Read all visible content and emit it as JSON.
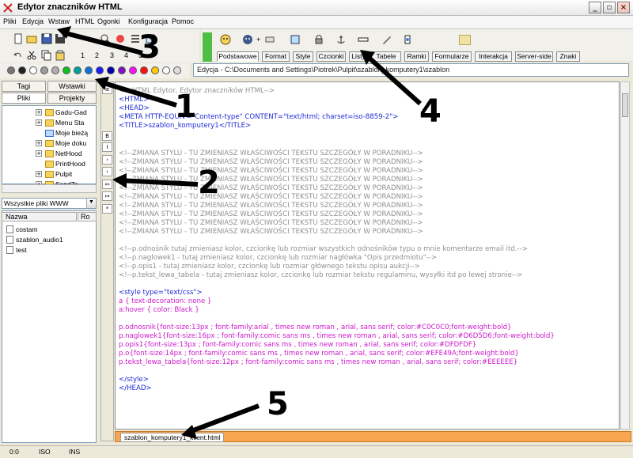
{
  "app": {
    "title": "Edytor znaczników HTML"
  },
  "menu": [
    "Pliki",
    "Edycja",
    "Wstaw",
    "HTML",
    "Ogonki",
    "Konfiguracja",
    "Pomoc"
  ],
  "toolbar": {
    "numbers": [
      "1",
      "2",
      "3",
      "4",
      "5"
    ],
    "tabs": [
      "Podstawowe",
      "Format",
      "Style",
      "Czcionki",
      "Listy",
      "Tabele",
      "Ramki",
      "Formularze",
      "Interakcja",
      "Server-side",
      "Znaki"
    ],
    "active_tab": "Podstawowe",
    "path": "Edycja - C:\\Documents and Settings\\Piotrek\\Pulpit\\szablon_komputery1\\szablon"
  },
  "left_panel": {
    "tabs_top": [
      "Tagi",
      "Wstawki"
    ],
    "tabs_bottom": [
      "Pliki",
      "Projekty"
    ],
    "tree": [
      "Gadu-Gad",
      "Menu Sta",
      "Moje bieżą",
      "Moje doku",
      "NetHood",
      "PrintHood",
      "Pulpit",
      "SendTo"
    ],
    "filter": "Wszystkie pliki WWW",
    "file_columns": [
      "Nazwa",
      "Ro"
    ],
    "files": [
      "costam",
      "szablon_audio1",
      "test"
    ]
  },
  "editor": {
    "lines": [
      {
        "text": "<!--HTML Edytor, Edytor znaczników HTML-->",
        "color": "#909090"
      },
      {
        "text": "<HTML>",
        "color": "#1e2bd8"
      },
      {
        "text": "<HEAD>",
        "color": "#1e2bd8"
      },
      {
        "text": "<META HTTP-EQUIV=\"Content-type\" CONTENT=\"text/html; charset=iso-8859-2\">",
        "color": "#1e2bd8"
      },
      {
        "text": "<TITLE>szablon_komputery1</TITLE>",
        "color": "#1e2bd8"
      },
      {
        "text": "",
        "color": "#000"
      },
      {
        "text": "",
        "color": "#000"
      },
      {
        "text": "<!--ZMIANA STYLU - TU ZMIENIASZ WŁAŚCIWOŚCI TEKSTU SZCZEGÓŁY W PORADNIKU-->",
        "color": "#909090"
      },
      {
        "text": "<!--ZMIANA STYLU - TU ZMIENIASZ WŁAŚCIWOŚCI TEKSTU SZCZEGÓŁY W PORADNIKU-->",
        "color": "#909090"
      },
      {
        "text": "<!--ZMIANA STYLU - TU ZMIENIASZ WŁAŚCIWOŚCI TEKSTU SZCZEGÓŁY W PORADNIKU-->",
        "color": "#909090"
      },
      {
        "text": "<!--ZMIANA STYLU - TU ZMIENIASZ WŁAŚCIWOŚCI TEKSTU SZCZEGÓŁY W PORADNIKU-->",
        "color": "#909090"
      },
      {
        "text": "<!--ZMIANA STYLU - TU ZMIENIASZ WŁAŚCIWOŚCI TEKSTU SZCZEGÓŁY W PORADNIKU-->",
        "color": "#909090"
      },
      {
        "text": "<!--ZMIANA STYLU - TU ZMIENIASZ WŁAŚCIWOŚCI TEKSTU SZCZEGÓŁY W PORADNIKU-->",
        "color": "#909090"
      },
      {
        "text": "<!--ZMIANA STYLU - TU ZMIENIASZ WŁAŚCIWOŚCI TEKSTU SZCZEGÓŁY W PORADNIKU-->",
        "color": "#909090"
      },
      {
        "text": "<!--ZMIANA STYLU - TU ZMIENIASZ WŁAŚCIWOŚCI TEKSTU SZCZEGÓŁY W PORADNIKU-->",
        "color": "#909090"
      },
      {
        "text": "<!--ZMIANA STYLU - TU ZMIENIASZ WŁAŚCIWOŚCI TEKSTU SZCZEGÓŁY W PORADNIKU-->",
        "color": "#909090"
      },
      {
        "text": "<!--ZMIANA STYLU - TU ZMIENIASZ WŁAŚCIWOŚCI TEKSTU SZCZEGÓŁY W PORADNIKU-->",
        "color": "#909090"
      },
      {
        "text": "",
        "color": "#000"
      },
      {
        "text": "<!--p.odnośnik tutaj zmieniasz kolor, czcionkę lub rozmiar wszystkich odnośników typu o mnie komentarze email itd.-->",
        "color": "#909090"
      },
      {
        "text": "<!--p.naglowek1 - tutaj zmieniasz kolor, czcionkę lub rozmiar nagłówka \"Opis przedmiotu\"-->",
        "color": "#909090"
      },
      {
        "text": "<!--p.opis1 - tutaj zmieniasz kolor, czcionkę lub rozmiar głównego tekstu opisu aukcji-->",
        "color": "#909090"
      },
      {
        "text": "<!--p.tekst_lewa_tabela - tutaj zmieniasz kolor, czcionkę lub rozmiar tekstu regulaminu, wysyłki itd po lewej stronie-->",
        "color": "#909090"
      },
      {
        "text": "",
        "color": "#000"
      },
      {
        "text": "<style type=\"text/css\">",
        "color": "#1e2bd8"
      },
      {
        "text": "a { text-decoration: none }",
        "color": "#cc19c9"
      },
      {
        "text": "a:hover { color: Black }",
        "color": "#cc19c9"
      },
      {
        "text": "",
        "color": "#000"
      },
      {
        "text": "p.odnosnik{font-size:13px ; font-family:arial , times new roman , arial, sans serif; color:#C0C0C0;font-weight:bold}",
        "color": "#cc19c9"
      },
      {
        "text": "p.naglowek1{font-size:16px ; font-family:comic sans ms , times new roman , arial, sans serif; color:#D6D5D6;font-weight:bold}",
        "color": "#cc19c9"
      },
      {
        "text": "p.opis1{font-size:13px ; font-family:comic sans ms , times new roman , arial, sans serif; color:#DFDFDF}",
        "color": "#cc19c9"
      },
      {
        "text": "p.o{font-size:14px ; font-family:comic sans ms , times new roman , arial, sans serif; color:#EFE49A;font-weight:bold}",
        "color": "#cc19c9"
      },
      {
        "text": "p.tekst_lewa_tabela{font-size:12px ; font-family:comic sans ms , times new roman , arial, sans serif; color:#EEEEEE}",
        "color": "#cc19c9"
      },
      {
        "text": "",
        "color": "#000"
      },
      {
        "text": "</style>",
        "color": "#1e2bd8"
      },
      {
        "text": "</HEAD>",
        "color": "#1e2bd8"
      }
    ]
  },
  "bottom_tab": "szablon_komputery1_klient.html",
  "status": [
    "0:0",
    "ISO",
    "INS"
  ],
  "annotations": [
    "1",
    "2",
    "3",
    "4",
    "5"
  ],
  "palette": [
    "#777777",
    "#222222",
    "#ffffff",
    "#9c9c9c",
    "#b0b0b0",
    "#10c020",
    "#00a0a0",
    "#1070e0",
    "#1c1cff",
    "#0000aa",
    "#8010c0",
    "#ff10ff",
    "#ff1010",
    "#ffcc00",
    "#ffffff",
    "#dddddd"
  ]
}
